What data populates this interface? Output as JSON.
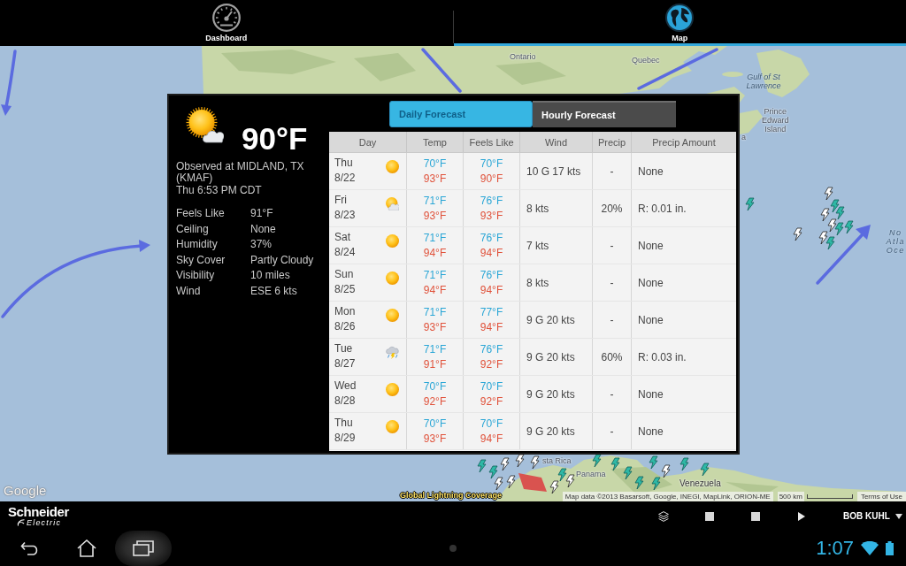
{
  "nav_tabs": [
    {
      "label": "Dashboard",
      "kind": "gauge",
      "selected": false
    },
    {
      "label": "Map",
      "kind": "globe",
      "selected": true
    }
  ],
  "map": {
    "labels": [
      {
        "text": "Ontario",
        "kind": "land"
      },
      {
        "text": "Quebec",
        "kind": "land"
      },
      {
        "text": "Gulf of St Lawrence",
        "kind": "water"
      },
      {
        "text": "Prince Edward Island",
        "kind": "land"
      },
      {
        "text": "a",
        "kind": "land"
      },
      {
        "text": "sta Rica",
        "kind": "land"
      },
      {
        "text": "Panama",
        "kind": "land"
      },
      {
        "text": "Venezuela",
        "kind": "land"
      },
      {
        "text": "No Atla Oce",
        "kind": "water"
      }
    ],
    "logo": "Google",
    "layer_title": "Global Lightning Coverage",
    "attribution": "Map data ©2013 Basarsoft, Google, INEGI, MapLink, ORION-ME",
    "scale": "500 km",
    "terms": "Terms of Use"
  },
  "weather": {
    "current": {
      "kind": "partlycloudy",
      "temperature": "90°F",
      "station": "Observed at MIDLAND, TX (KMAF)",
      "time": "Thu 6:53 PM CDT",
      "details": [
        {
          "label": "Feels Like",
          "value": "91°F"
        },
        {
          "label": "Ceiling",
          "value": "None"
        },
        {
          "label": "Humidity",
          "value": "37%"
        },
        {
          "label": "Sky Cover",
          "value": "Partly Cloudy"
        },
        {
          "label": "Visibility",
          "value": "10 miles"
        },
        {
          "label": "Wind",
          "value": "ESE 6 kts"
        }
      ]
    },
    "tabs": [
      {
        "label": "Daily Forecast",
        "selected": true
      },
      {
        "label": "Hourly Forecast",
        "selected": false
      }
    ],
    "table": {
      "columns": [
        "Day",
        "Temp",
        "Feels Like",
        "Wind",
        "Precip",
        "Precip Amount"
      ],
      "rows": [
        {
          "day": "Thu",
          "date": "8/22",
          "kind": "sunny",
          "temp_low": "70°F",
          "temp_high": "93°F",
          "feels_low": "70°F",
          "feels_high": "90°F",
          "wind": "10 G 17 kts",
          "precip": "-",
          "amount": "None"
        },
        {
          "day": "Fri",
          "date": "8/23",
          "kind": "partlycloudy",
          "temp_low": "71°F",
          "temp_high": "93°F",
          "feels_low": "76°F",
          "feels_high": "93°F",
          "wind": "8 kts",
          "precip": "20%",
          "amount": "R: 0.01 in."
        },
        {
          "day": "Sat",
          "date": "8/24",
          "kind": "sunny",
          "temp_low": "71°F",
          "temp_high": "94°F",
          "feels_low": "76°F",
          "feels_high": "94°F",
          "wind": "7 kts",
          "precip": "-",
          "amount": "None"
        },
        {
          "day": "Sun",
          "date": "8/25",
          "kind": "sunny",
          "temp_low": "71°F",
          "temp_high": "94°F",
          "feels_low": "76°F",
          "feels_high": "94°F",
          "wind": "8 kts",
          "precip": "-",
          "amount": "None"
        },
        {
          "day": "Mon",
          "date": "8/26",
          "kind": "sunny",
          "temp_low": "71°F",
          "temp_high": "93°F",
          "feels_low": "77°F",
          "feels_high": "94°F",
          "wind": "9 G 20 kts",
          "precip": "-",
          "amount": "None"
        },
        {
          "day": "Tue",
          "date": "8/27",
          "kind": "thunderstorm",
          "temp_low": "71°F",
          "temp_high": "91°F",
          "feels_low": "76°F",
          "feels_high": "92°F",
          "wind": "9 G 20 kts",
          "precip": "60%",
          "amount": "R: 0.03 in."
        },
        {
          "day": "Wed",
          "date": "8/28",
          "kind": "sunny",
          "temp_low": "70°F",
          "temp_high": "92°F",
          "feels_low": "70°F",
          "feels_high": "92°F",
          "wind": "9 G 20 kts",
          "precip": "-",
          "amount": "None"
        },
        {
          "day": "Thu",
          "date": "8/29",
          "kind": "sunny",
          "temp_low": "70°F",
          "temp_high": "93°F",
          "feels_low": "70°F",
          "feels_high": "94°F",
          "wind": "9 G 20 kts",
          "precip": "-",
          "amount": "None"
        }
      ]
    }
  },
  "app_bar": {
    "logo": {
      "top": "Schneider",
      "bottom": "Electric"
    },
    "tools": [
      {
        "kind": "layers"
      },
      {
        "kind": "stop"
      },
      {
        "kind": "stop"
      },
      {
        "kind": "play"
      }
    ],
    "user": "BOB KUHL"
  },
  "system_bar": {
    "buttons": [
      {
        "kind": "back",
        "highlighted": false
      },
      {
        "kind": "home",
        "highlighted": false
      },
      {
        "kind": "recents",
        "highlighted": true
      }
    ],
    "time": "1:07"
  }
}
